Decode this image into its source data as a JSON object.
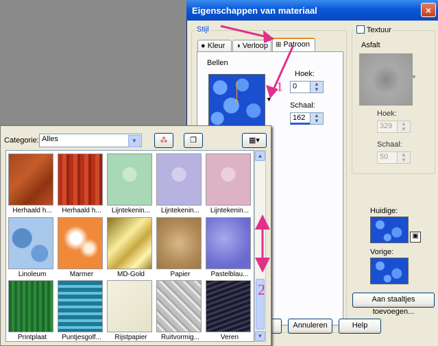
{
  "dialog": {
    "title": "Eigenschappen van materiaal",
    "close_label": "×",
    "stijl_label": "Stijl",
    "tabs": [
      {
        "label": "Kleur"
      },
      {
        "label": "Verloop"
      },
      {
        "label": "Patroon"
      }
    ],
    "pattern_name": "Bellen",
    "hoek_label": "Hoek:",
    "hoek_value": "0",
    "schaal_label": "Schaal:",
    "schaal_value": "162",
    "texture_checkbox_label": "Textuur",
    "texture_name": "Asfalt",
    "texture_hoek_label": "Hoek:",
    "texture_hoek_value": "329",
    "texture_schaal_label": "Schaal:",
    "texture_schaal_value": "50",
    "huidige_label": "Huidige:",
    "vorige_label": "Vorige:",
    "add_button": "Aan staaltjes toevoegen...",
    "cancel_button": "Annuleren",
    "help_button": "Help"
  },
  "annotations": {
    "marker_1": "1",
    "marker_2": "2",
    "accent_color": "#e0308a"
  },
  "popup": {
    "category_label": "Categorie:",
    "category_value": "Alles",
    "tiles": [
      {
        "label": "Herhaald h...",
        "style": "rust"
      },
      {
        "label": "Herhaald h...",
        "style": "redwood"
      },
      {
        "label": "Lijntekenin...",
        "style": "green-line"
      },
      {
        "label": "Lijntekenin...",
        "style": "lavender-line"
      },
      {
        "label": "Lijntekenin...",
        "style": "pink-line"
      },
      {
        "label": "Linoleum",
        "style": "linoleum"
      },
      {
        "label": "Marmer",
        "style": "marble"
      },
      {
        "label": "MD-Gold",
        "style": "gold"
      },
      {
        "label": "Papier",
        "style": "paper"
      },
      {
        "label": "Pastelblau...",
        "style": "pastel-blue"
      },
      {
        "label": "Printplaat",
        "style": "circuit"
      },
      {
        "label": "Puntjesgolf...",
        "style": "dots-wave"
      },
      {
        "label": "Rijstpapier",
        "style": "rice-paper"
      },
      {
        "label": "Ruitvormig...",
        "style": "diamond-plate"
      },
      {
        "label": "Veren",
        "style": "feathers"
      }
    ]
  }
}
